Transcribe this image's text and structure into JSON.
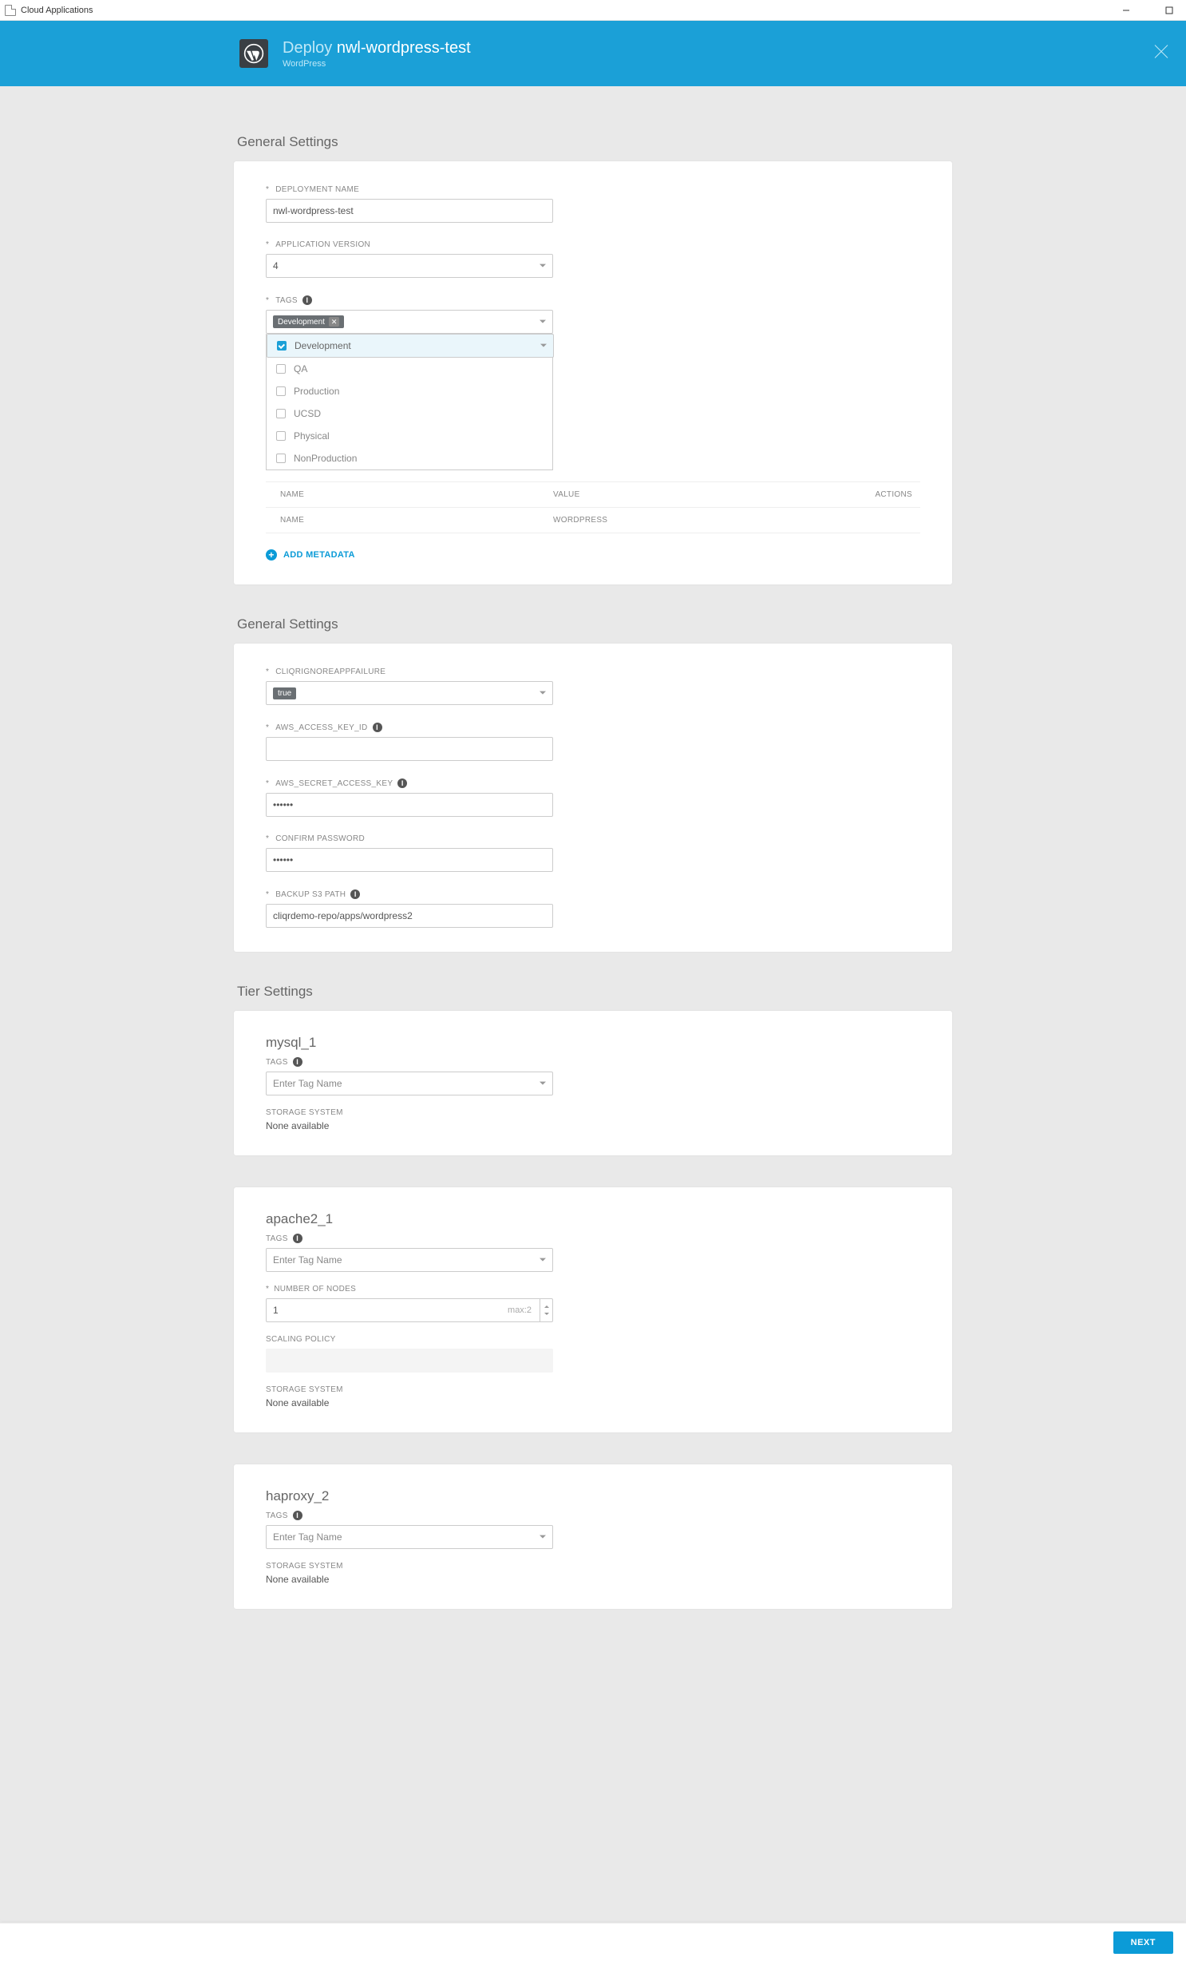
{
  "window": {
    "title": "Cloud Applications"
  },
  "header": {
    "deploy_word": "Deploy",
    "app_name": "nwl-wordpress-test",
    "subtitle": "WordPress"
  },
  "section_general1": {
    "title": "General Settings",
    "deployment_name_label": "DEPLOYMENT NAME",
    "deployment_name_value": "nwl-wordpress-test",
    "application_version_label": "APPLICATION VERSION",
    "application_version_value": "4",
    "tags_label": "TAGS",
    "tags_chip": "Development",
    "tags_options": [
      {
        "label": "Development",
        "checked": true
      },
      {
        "label": "QA",
        "checked": false
      },
      {
        "label": "Production",
        "checked": false
      },
      {
        "label": "UCSD",
        "checked": false
      },
      {
        "label": "Physical",
        "checked": false
      },
      {
        "label": "NonProduction",
        "checked": false
      }
    ],
    "meta_headers": {
      "name": "NAME",
      "value": "VALUE",
      "actions": "ACTIONS"
    },
    "meta_row": {
      "name": "NAME",
      "value": "WORDPRESS"
    },
    "add_metadata_label": "ADD METADATA"
  },
  "section_general2": {
    "title": "General Settings",
    "cliq_label": "CLIQRIGNOREAPPFAILURE",
    "cliq_value": "true",
    "aws_key_label": "AWS_ACCESS_KEY_ID",
    "aws_key_value": "",
    "aws_secret_label": "AWS_SECRET_ACCESS_KEY",
    "aws_secret_value": "••••••",
    "confirm_pw_label": "CONFIRM PASSWORD",
    "confirm_pw_value": "••••••",
    "backup_label": "BACKUP S3 PATH",
    "backup_value": "cliqrdemo-repo/apps/wordpress2"
  },
  "tier": {
    "title": "Tier Settings",
    "tags_label": "TAGS",
    "tag_placeholder": "Enter Tag Name",
    "storage_label": "STORAGE SYSTEM",
    "none_avail": "None available",
    "mysql": {
      "title": "mysql_1"
    },
    "apache": {
      "title": "apache2_1",
      "nodes_label": "NUMBER OF NODES",
      "nodes_value": "1",
      "nodes_hint": "max:2",
      "scaling_label": "SCALING POLICY"
    },
    "haproxy": {
      "title": "haproxy_2"
    }
  },
  "footer": {
    "next": "NEXT"
  },
  "asterisk": "*"
}
